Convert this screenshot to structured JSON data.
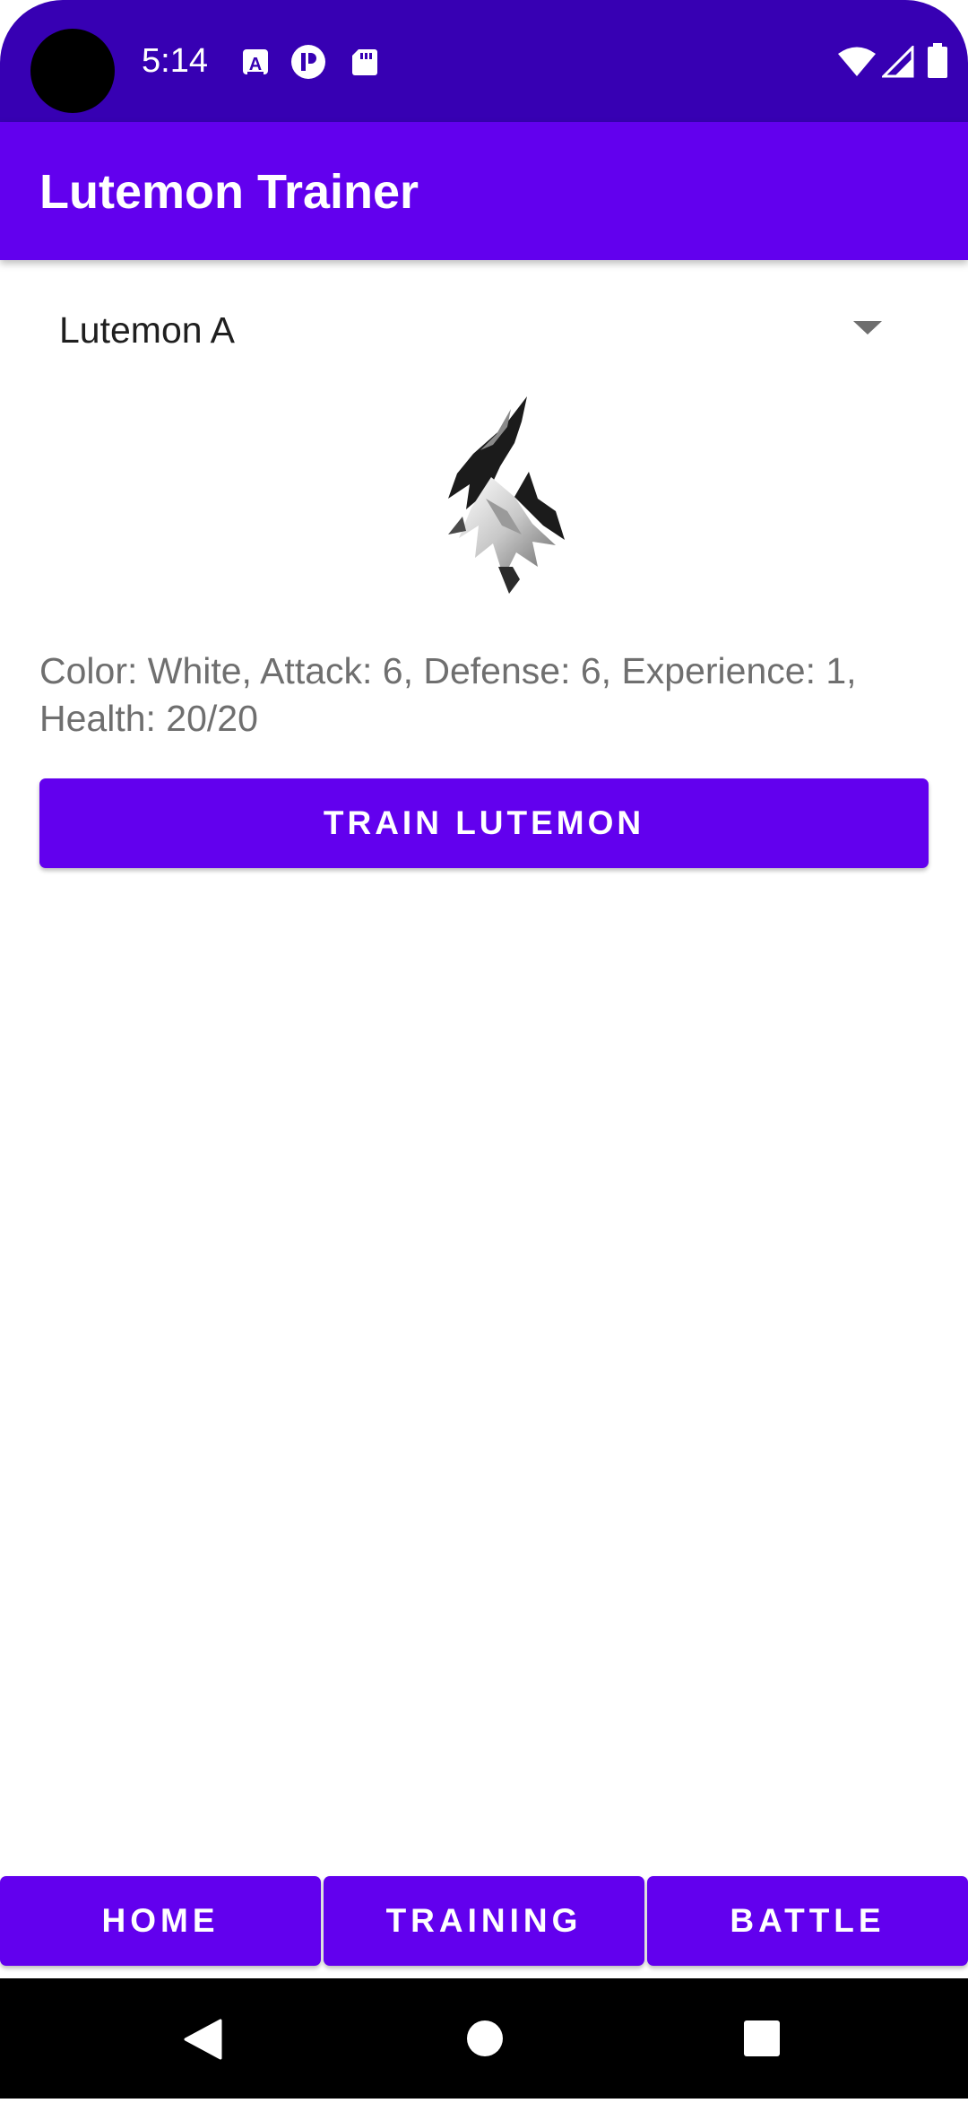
{
  "status_bar": {
    "time": "5:14",
    "icons": [
      "a-badge-icon",
      "p-circle-icon",
      "sd-card-icon",
      "wifi-icon",
      "signal-icon",
      "battery-icon"
    ]
  },
  "app_bar": {
    "title": "Lutemon Trainer"
  },
  "spinner": {
    "selected": "Lutemon A"
  },
  "lutemon": {
    "image": "white-lutemon-sprite",
    "stats": "Color: White, Attack: 6, Defense: 6, Experience: 1, Health: 20/20"
  },
  "actions": {
    "train_label": "TRAIN LUTEMON"
  },
  "bottom_nav": {
    "home": "HOME",
    "training": "TRAINING",
    "battle": "BATTLE"
  },
  "system_nav": {
    "icons": [
      "back-icon",
      "home-circle-icon",
      "recents-icon"
    ]
  },
  "colors": {
    "status_bar": "#3700b3",
    "primary": "#6200ee",
    "secondary_text": "#6f6f6f",
    "nav_background": "#000000"
  }
}
